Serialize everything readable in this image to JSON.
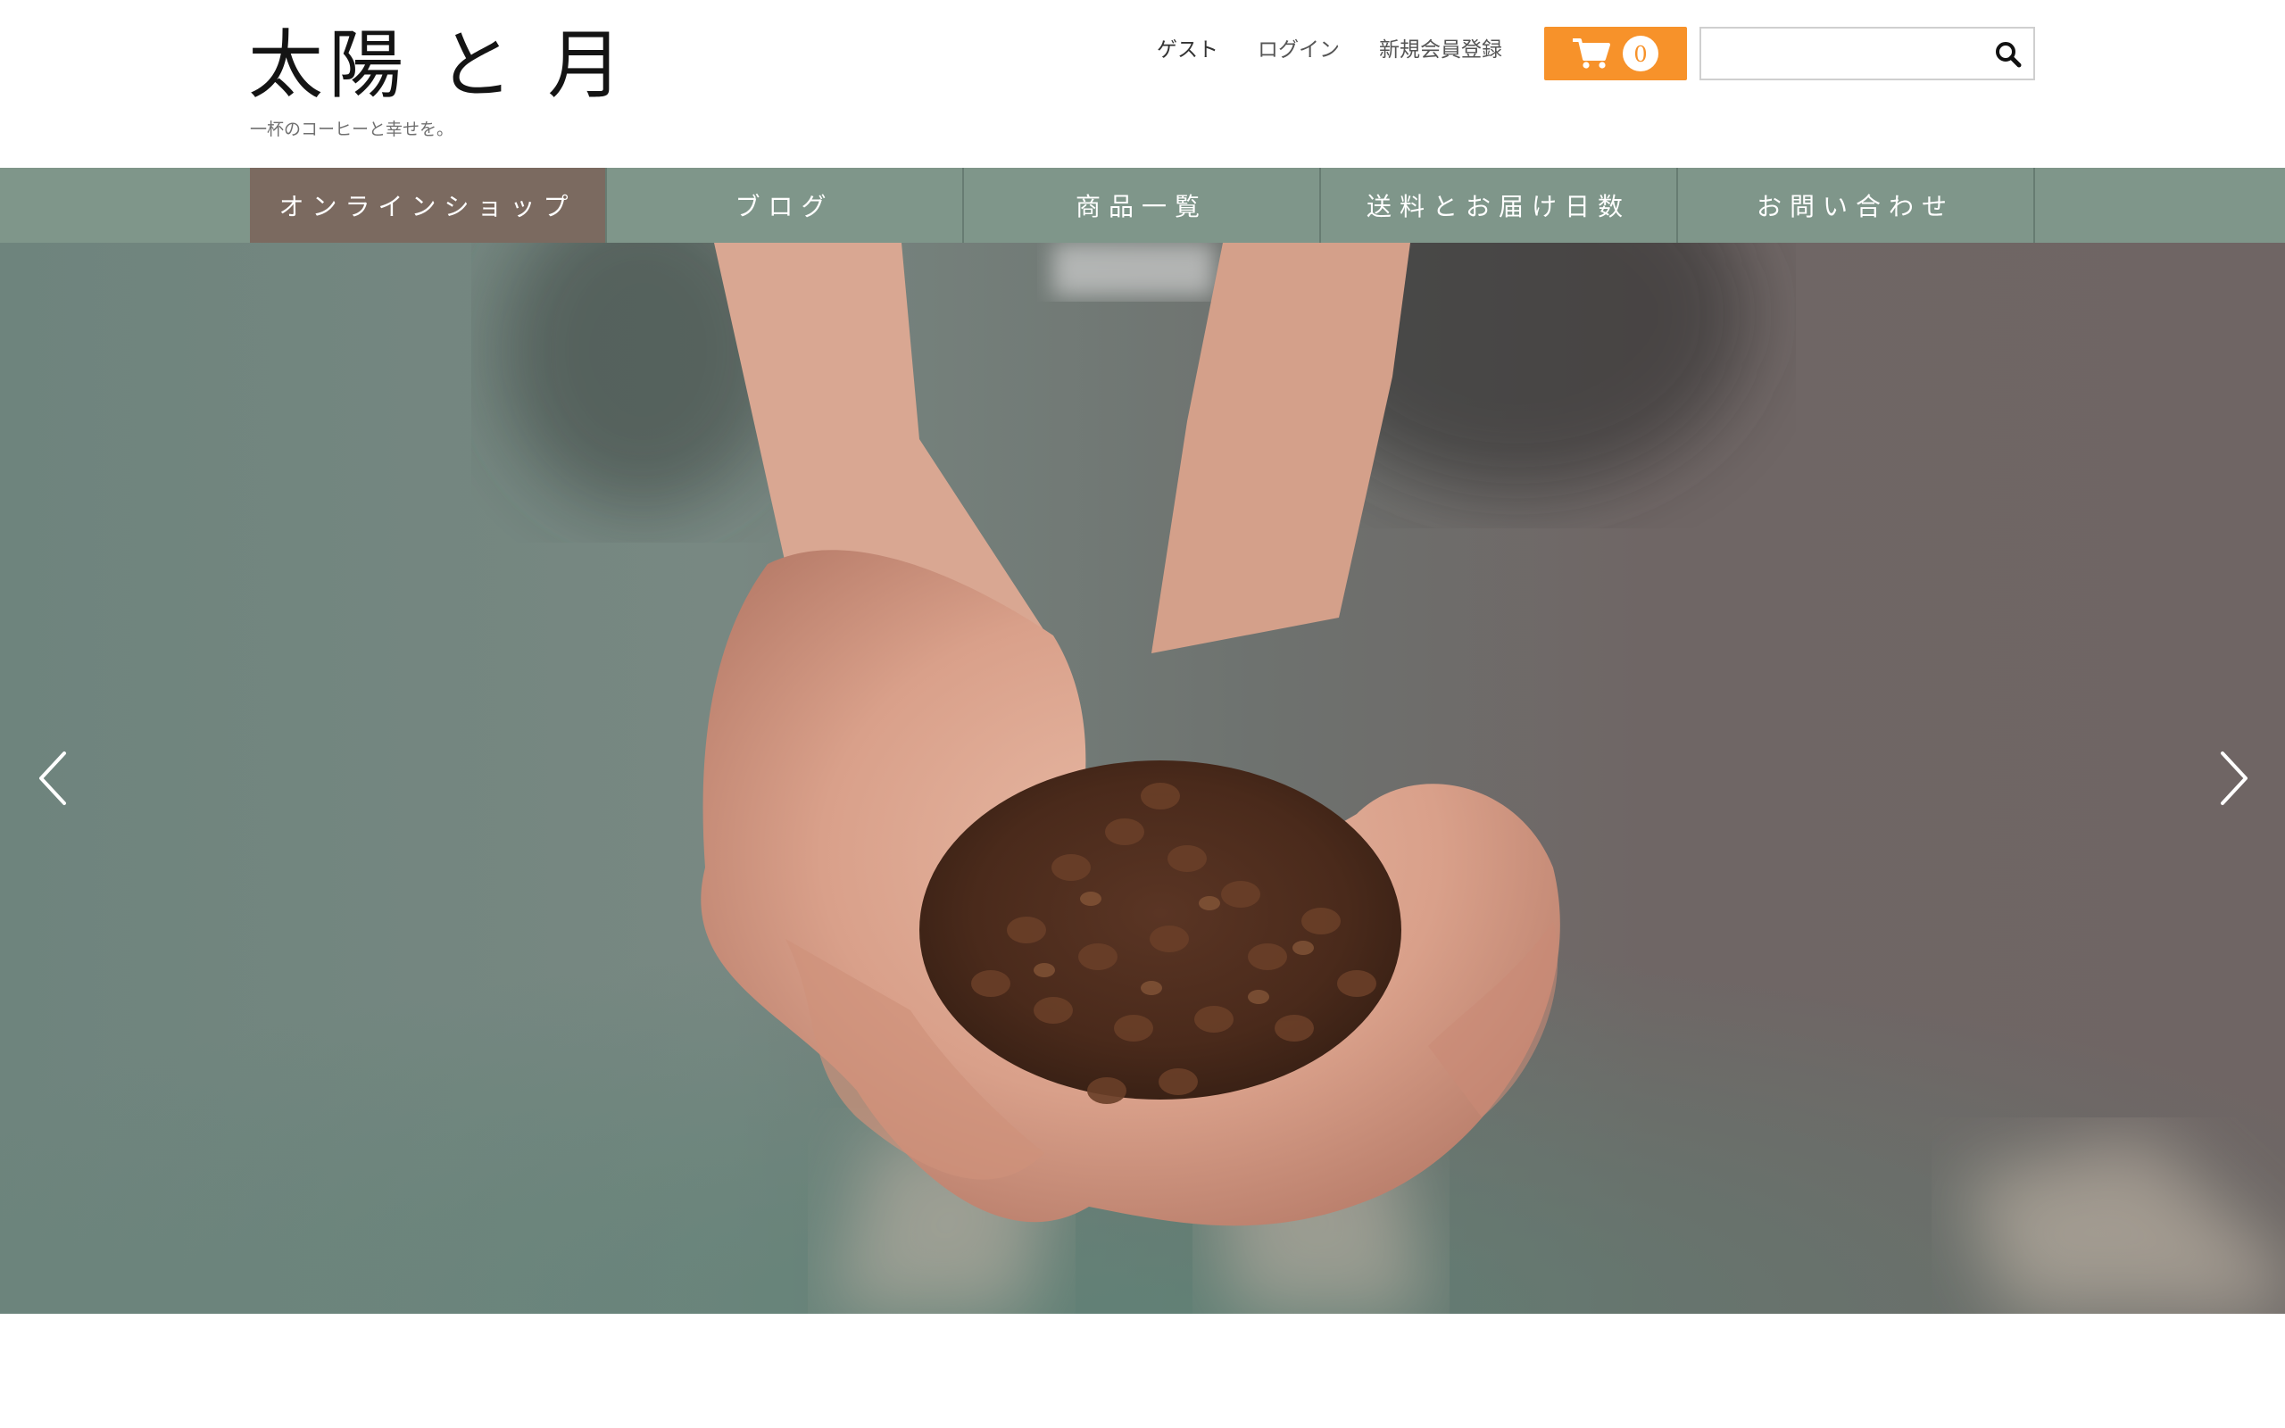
{
  "header": {
    "site_title": "太陽 と 月",
    "tagline": "一杯のコーヒーと幸せを。",
    "user_links": {
      "guest": "ゲスト",
      "login": "ログイン",
      "register": "新規会員登録"
    },
    "cart": {
      "count": "0",
      "icon": "cart-icon"
    },
    "search": {
      "value": "",
      "placeholder": "",
      "icon": "search-icon"
    }
  },
  "nav": {
    "items": [
      {
        "label": "オンラインショップ",
        "active": true
      },
      {
        "label": "ブログ",
        "active": false
      },
      {
        "label": "商品一覧",
        "active": false
      },
      {
        "label": "送料とお届け日数",
        "active": false
      },
      {
        "label": "お問い合わせ",
        "active": false
      }
    ]
  },
  "hero": {
    "image": "hands-holding-coffee-beans",
    "prev_icon": "chevron-left-icon",
    "next_icon": "chevron-right-icon"
  },
  "colors": {
    "nav_bg": "#7f968a",
    "nav_active_bg": "#7b6a60",
    "cart_accent": "#f7922a"
  }
}
